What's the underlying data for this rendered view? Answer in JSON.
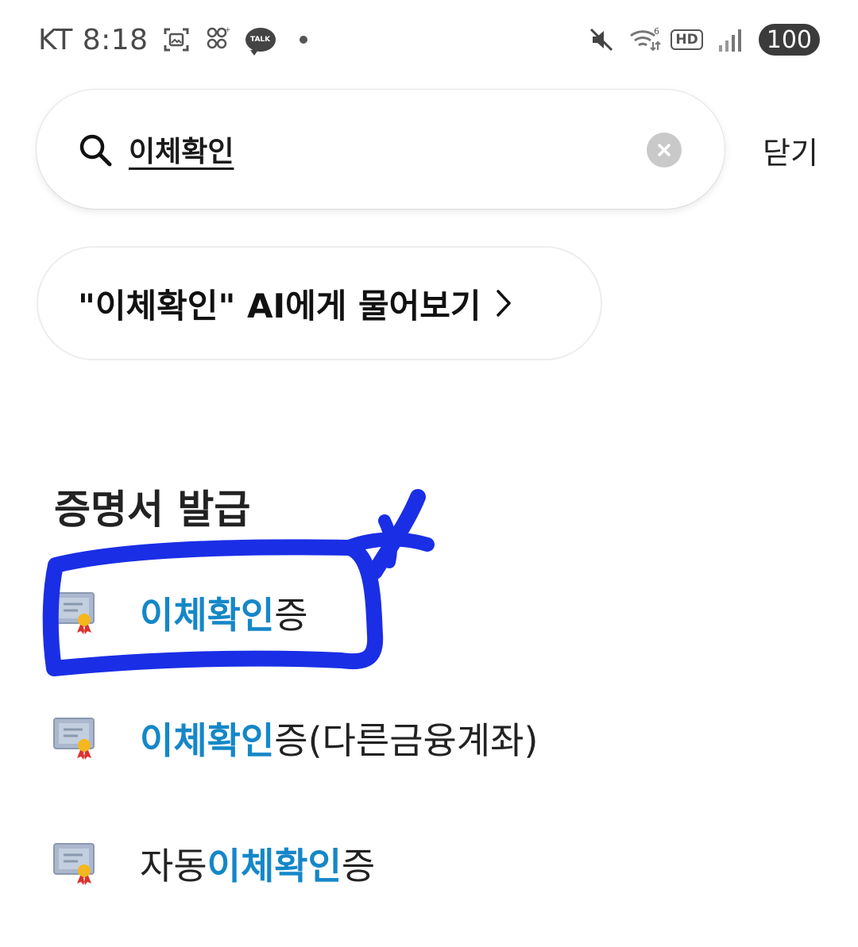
{
  "status_bar": {
    "carrier_time": "KT 8:18",
    "talk_badge": "TALK",
    "battery": "100",
    "hd_label": "HD",
    "icons": [
      "screenshot-icon",
      "game-icon",
      "kakaotalk-icon",
      "notification-dot",
      "mute-icon",
      "wifi-icon",
      "hd-voice-icon",
      "signal-icon",
      "battery-icon"
    ]
  },
  "search": {
    "value": "이체확인",
    "placeholder": "",
    "close_label": "닫기"
  },
  "ai_chip": {
    "label": "\"이체확인\" AI에게 물어보기"
  },
  "section": {
    "title": "증명서 발급",
    "items": [
      {
        "prefix": "",
        "highlight": "이체확인",
        "suffix": "증",
        "icon": "certificate-icon"
      },
      {
        "prefix": "",
        "highlight": "이체확인",
        "suffix": "증(다른금융계좌)",
        "icon": "certificate-icon"
      },
      {
        "prefix": "자동",
        "highlight": "이체확인",
        "suffix": "증",
        "icon": "certificate-icon"
      }
    ]
  },
  "colors": {
    "highlight": "#1587c8",
    "annotation": "#1a2ee6"
  }
}
